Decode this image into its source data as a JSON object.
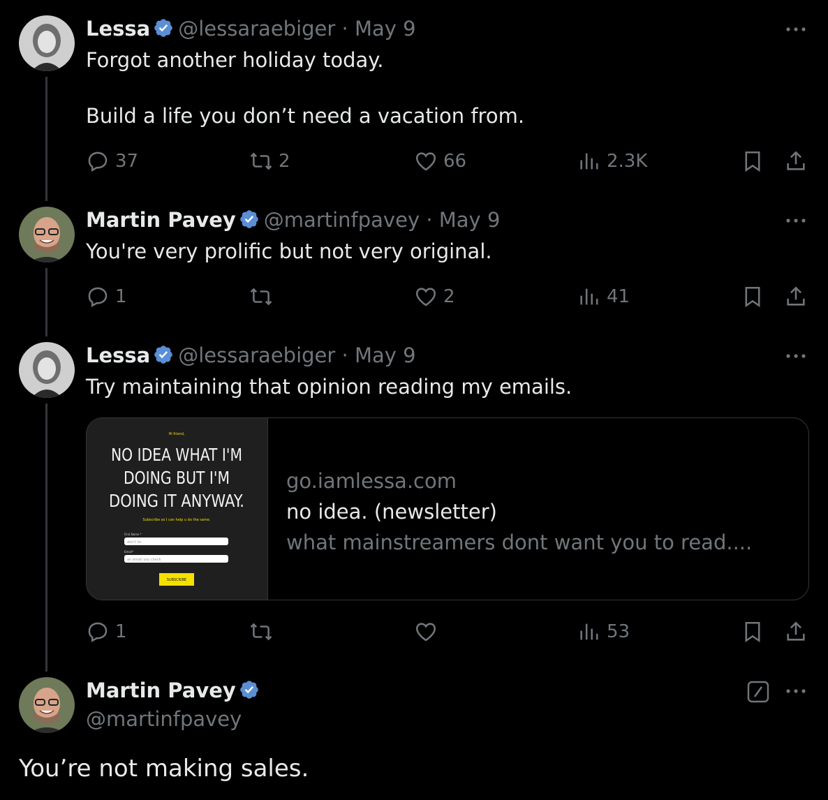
{
  "tweets": [
    {
      "name": "Lessa",
      "handle": "@lessaraebiger",
      "sep": "·",
      "date": "May 9",
      "text": "Forgot another holiday today.\n\nBuild a life you don’t need a vacation from.",
      "stats": {
        "replies": "37",
        "reposts": "2",
        "likes": "66",
        "views": "2.3K"
      }
    },
    {
      "name": "Martin Pavey",
      "handle": "@martinfpavey",
      "sep": "·",
      "date": "May 9",
      "text": "You're very prolific but not very original.",
      "stats": {
        "replies": "1",
        "reposts": "",
        "likes": "2",
        "views": "41"
      }
    },
    {
      "name": "Lessa",
      "handle": "@lessaraebiger",
      "sep": "·",
      "date": "May 9",
      "text": "Try maintaining that opinion reading my emails.",
      "stats": {
        "replies": "1",
        "reposts": "",
        "likes": "",
        "views": "53"
      },
      "card": {
        "image": {
          "greeting": "Hi friend,",
          "headline_1": "NO IDEA WHAT I'M",
          "headline_2": "DOING BUT I'M",
          "headline_3": "DOING IT ANYWAY.",
          "subline": "Subscribe so I can help u do the same.",
          "first_name_label": "First Name *",
          "first_name_value": "don't lie",
          "email_label": "Email*",
          "email_value": "an email you check",
          "button": "SUBSCRIBE"
        },
        "domain": "go.iamlessa.com",
        "title": "no idea. (newsletter)",
        "description": "what mainstreamers dont want you to read...."
      }
    }
  ],
  "main": {
    "name": "Martin Pavey",
    "handle": "@martinfpavey",
    "text": "You’re not making sales."
  },
  "colors": {
    "accent": "#1d9bf0",
    "verified": "#5a8fd6",
    "muted": "#71767b",
    "text": "#e7e9ea",
    "border": "#333639",
    "card_button": "#f5e000"
  },
  "icons": [
    "verified-badge-icon",
    "more-options-icon",
    "reply-icon",
    "repost-icon",
    "like-icon",
    "views-icon",
    "bookmark-icon",
    "share-icon",
    "grok-icon"
  ]
}
